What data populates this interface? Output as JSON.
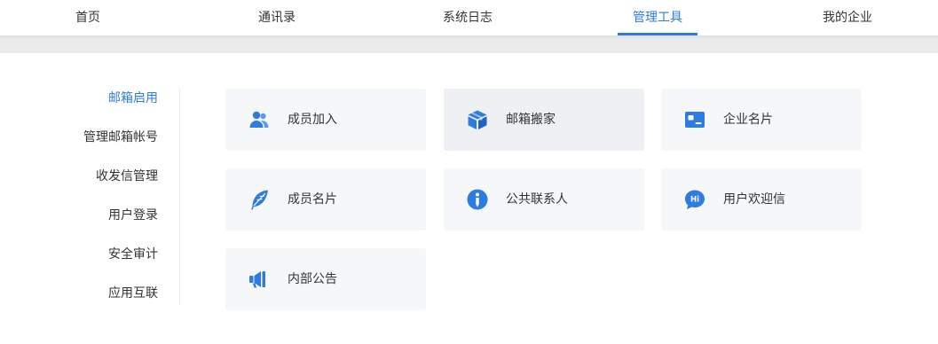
{
  "nav": {
    "tabs": [
      {
        "label": "首页"
      },
      {
        "label": "通讯录"
      },
      {
        "label": "系统日志"
      },
      {
        "label": "管理工具"
      },
      {
        "label": "我的企业"
      }
    ]
  },
  "sidebar": {
    "items": [
      {
        "label": "邮箱启用"
      },
      {
        "label": "管理邮箱帐号"
      },
      {
        "label": "收发信管理"
      },
      {
        "label": "用户登录"
      },
      {
        "label": "安全审计"
      },
      {
        "label": "应用互联"
      }
    ]
  },
  "tools": {
    "cards": [
      {
        "label": "成员加入",
        "icon": "add-member-icon"
      },
      {
        "label": "邮箱搬家",
        "icon": "box-icon"
      },
      {
        "label": "企业名片",
        "icon": "business-card-icon"
      },
      {
        "label": "成员名片",
        "icon": "feather-icon"
      },
      {
        "label": "公共联系人",
        "icon": "contact-info-icon"
      },
      {
        "label": "用户欢迎信",
        "icon": "hi-chat-icon"
      },
      {
        "label": "内部公告",
        "icon": "megaphone-icon"
      }
    ]
  },
  "colors": {
    "accent": "#2e7ce0",
    "card_bg": "#f6f7f9",
    "band": "#ebebeb"
  }
}
